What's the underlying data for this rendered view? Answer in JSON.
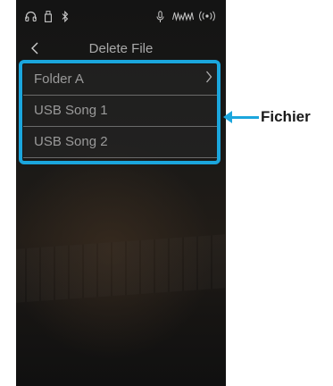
{
  "status_icons": [
    "headphones-icon",
    "usb-icon",
    "bluetooth-icon",
    "microphone-icon",
    "audio-wave-icon",
    "wireless-icon"
  ],
  "nav": {
    "title": "Delete File"
  },
  "files": [
    {
      "label": "Folder A",
      "has_chevron": true
    },
    {
      "label": "USB Song 1",
      "has_chevron": false
    },
    {
      "label": "USB Song 2",
      "has_chevron": false
    }
  ],
  "callout": {
    "label": "Fichier"
  },
  "colors": {
    "accent": "#1ba6dd",
    "screen_bg": "#1a1917",
    "text": "#9a9a9a"
  }
}
